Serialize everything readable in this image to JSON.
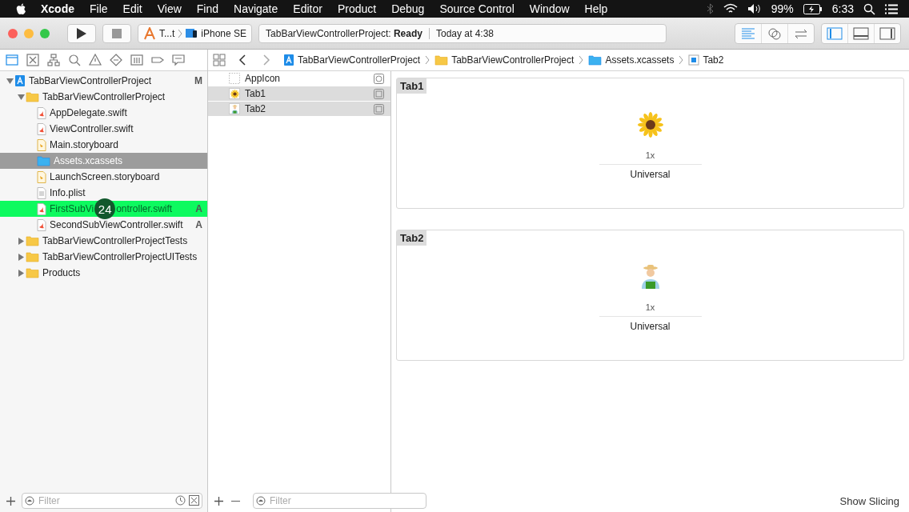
{
  "menu_bar": {
    "app": "Xcode",
    "menus": [
      "File",
      "Edit",
      "View",
      "Find",
      "Navigate",
      "Editor",
      "Product",
      "Debug",
      "Source Control",
      "Window",
      "Help"
    ],
    "battery": "99%",
    "time": "6:33"
  },
  "toolbar": {
    "scheme": "T...t",
    "device": "iPhone SE",
    "activity_project": "TabBarViewControllerProject:",
    "activity_status": "Ready",
    "activity_time": "Today at 4:38",
    "editor_modes": [
      {
        "kind": "standard",
        "selected": true
      },
      {
        "kind": "assistant",
        "selected": false
      },
      {
        "kind": "version",
        "selected": false
      }
    ],
    "panels": [
      {
        "kind": "navigator",
        "on": true
      },
      {
        "kind": "debug",
        "on": false
      },
      {
        "kind": "utilities",
        "on": false
      }
    ]
  },
  "navigator_tabs": [
    {
      "kind": "project",
      "selected": true
    },
    {
      "kind": "source",
      "selected": false
    },
    {
      "kind": "symbol",
      "selected": false
    },
    {
      "kind": "find",
      "selected": false
    },
    {
      "kind": "issue",
      "selected": false
    },
    {
      "kind": "test",
      "selected": false
    },
    {
      "kind": "debug",
      "selected": false
    },
    {
      "kind": "breakpoint",
      "selected": false
    },
    {
      "kind": "report",
      "selected": false
    }
  ],
  "tree": [
    {
      "name": "TabBarViewControllerProject",
      "kind": "project",
      "expanded": true,
      "status": "M",
      "selected": false,
      "highlighted": false,
      "children": [
        {
          "name": "TabBarViewControllerProject",
          "kind": "folder",
          "expanded": true,
          "selected": false,
          "highlighted": false,
          "children": [
            {
              "name": "AppDelegate.swift",
              "kind": "swift",
              "selected": false,
              "highlighted": false
            },
            {
              "name": "ViewController.swift",
              "kind": "swift",
              "selected": false,
              "highlighted": false
            },
            {
              "name": "Main.storyboard",
              "kind": "storyboard",
              "selected": false,
              "highlighted": false
            },
            {
              "name": "Assets.xcassets",
              "kind": "assets",
              "selected": true,
              "highlighted": false
            },
            {
              "name": "LaunchScreen.storyboard",
              "kind": "storyboard",
              "selected": false,
              "highlighted": false
            },
            {
              "name": "Info.plist",
              "kind": "plist",
              "selected": false,
              "highlighted": false
            },
            {
              "name": "FirstSubVi",
              "name_after_marker": "ontroller.swift",
              "kind": "swift",
              "status": "A",
              "selected": false,
              "highlighted": true,
              "step_marker": "24"
            },
            {
              "name": "SecondSubViewController.swift",
              "kind": "swift",
              "status": "A",
              "selected": false,
              "highlighted": false
            }
          ]
        },
        {
          "name": "TabBarViewControllerProjectTests",
          "kind": "folder",
          "expanded": false,
          "selected": false,
          "highlighted": false
        },
        {
          "name": "TabBarViewControllerProjectUITests",
          "kind": "folder",
          "expanded": false,
          "selected": false,
          "highlighted": false
        },
        {
          "name": "Products",
          "kind": "folder",
          "expanded": false,
          "selected": false,
          "highlighted": false
        }
      ]
    }
  ],
  "navigator_filter": {
    "placeholder": "Filter"
  },
  "jump_bar": [
    {
      "name": "TabBarViewControllerProject",
      "kind": "project"
    },
    {
      "name": "TabBarViewControllerProject",
      "kind": "folder"
    },
    {
      "name": "Assets.xcassets",
      "kind": "assets"
    },
    {
      "name": "Tab2",
      "kind": "imageset"
    }
  ],
  "assets": [
    {
      "name": "AppIcon",
      "kind": "appicon",
      "selected": false
    },
    {
      "name": "Tab1",
      "kind": "sunflower",
      "selected": true
    },
    {
      "name": "Tab2",
      "kind": "figure",
      "selected": true
    }
  ],
  "asset_filter": {
    "placeholder": "Filter"
  },
  "image_sets": [
    {
      "name": "Tab1",
      "kind": "sunflower",
      "scale": "1x",
      "idiom": "Universal"
    },
    {
      "name": "Tab2",
      "kind": "figure",
      "scale": "1x",
      "idiom": "Universal"
    }
  ],
  "show_slicing": "Show Slicing"
}
